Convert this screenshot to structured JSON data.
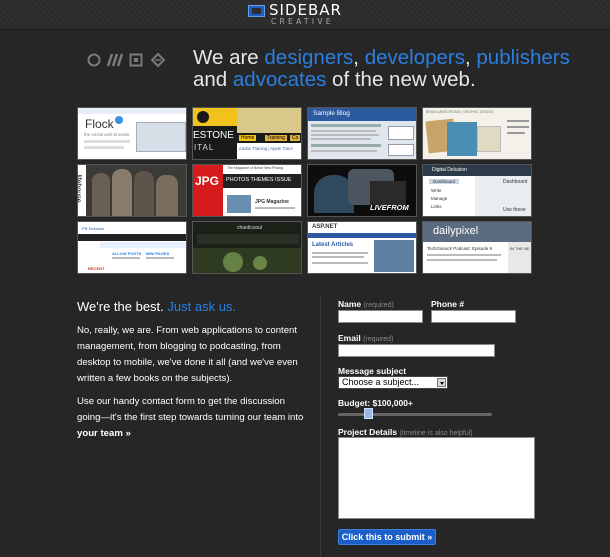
{
  "header": {
    "logo_word": "SIDEBAR",
    "logo_sub": "CREATIVE"
  },
  "hero": {
    "p1": "We are ",
    "w1": "designers",
    "p2": ", ",
    "w2": "developers",
    "p3": ", ",
    "w3": "publishers",
    "p4": "and ",
    "w4": "advocates",
    "p5": " of the new web.",
    "icons": [
      "circle-icon",
      "stripes-icon",
      "square-icon",
      "diamond-icon"
    ]
  },
  "portfolio": [
    {
      "label": "Flock",
      "sub": "the social web browser"
    },
    {
      "label": "ESTONE",
      "sub": "ITAL",
      "tabs": [
        "Home",
        "Training",
        "Co"
      ],
      "links": "Adobe Training | Apple Traini"
    },
    {
      "label": "Sample Blog"
    },
    {
      "label": "BRIAN ARMSTRONG | GRAPHIC DESIGN"
    },
    {
      "label": "lifehouse"
    },
    {
      "label": "JPG",
      "nav": "PHOTOS  THEMES  ISSUE",
      "mag": "The Magazine of Brave New Photog",
      "title": "JPG Magazine"
    },
    {
      "label": "LIVEFROM"
    },
    {
      "label": "Digital Delusion",
      "menu": [
        "Dashboard",
        "Write",
        "Manage",
        "Links"
      ],
      "side": "Dashboard",
      "side2": "Use these"
    },
    {
      "label": "PR Delusion",
      "cols": [
        "ALLOW POSTS",
        "MINI PAGES"
      ],
      "foot": "RECENT"
    },
    {
      "label": "chaoticsoul"
    },
    {
      "label": "ASP.NET",
      "head": "Latest Articles"
    },
    {
      "label": "dailypixel",
      "sub": "TechGanack Podcast: Episode 9",
      "side": "IN THE NE"
    }
  ],
  "intro": {
    "head_a": "We're the best.",
    "head_b": "Just ask us.",
    "para1": "No, really, we are. From web applications to content management, from blogging to podcasting, from desktop to mobile, we've done it all (and we've even written a few books on the subjects).",
    "para2_a": "Use our handy contact form to get the discussion going—it's the first step towards turning our team into ",
    "para2_b": "your",
    "para2_c": " team »"
  },
  "form": {
    "name_label": "Name",
    "name_hint": "(required)",
    "phone_label": "Phone #",
    "email_label": "Email",
    "email_hint": "(required)",
    "subject_label": "Message subject",
    "subject_value": "Choose a subject...",
    "budget_label": "Budget: $100,000+",
    "budget_level": 0.18,
    "details_label": "Project Details",
    "details_hint": "(timeline is also helpful)",
    "submit_label": "Click this to submit »"
  }
}
